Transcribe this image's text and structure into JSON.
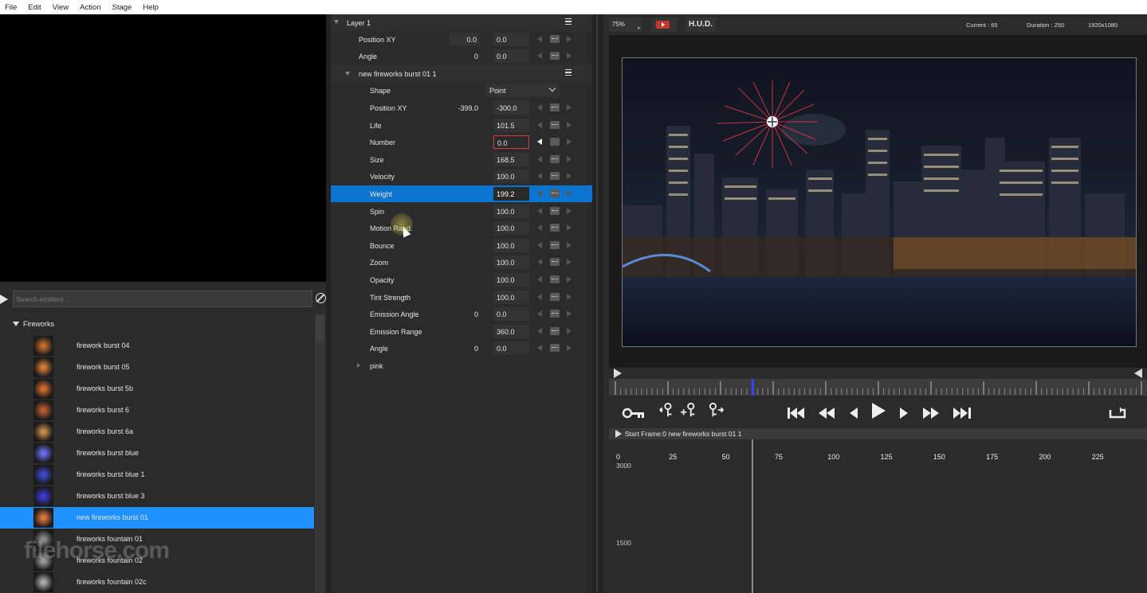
{
  "menu": [
    "File",
    "Edit",
    "View",
    "Action",
    "Stage",
    "Help"
  ],
  "search": {
    "placeholder": "Search emitters ..."
  },
  "emitters": {
    "group": "Fireworks",
    "items": [
      {
        "label": "firework burst 04",
        "color": "#c46a2a"
      },
      {
        "label": "firework burst 05",
        "color": "#d27a34"
      },
      {
        "label": "fireworks burst 5b",
        "color": "#cf6a2c"
      },
      {
        "label": "fireworks burst 6",
        "color": "#b65a32"
      },
      {
        "label": "fireworks burst 6a",
        "color": "#c8874a"
      },
      {
        "label": "fireworks burst blue",
        "color": "#6a6af0"
      },
      {
        "label": "fireworks burst blue 1",
        "color": "#3c48c8"
      },
      {
        "label": "fireworks burst blue 3",
        "color": "#3a3ad2"
      },
      {
        "label": "new fireworks burst 01",
        "color": "#d9763a",
        "selected": true
      },
      {
        "label": "fireworks fountain 01",
        "color": "#8a8a8a"
      },
      {
        "label": "fireworks fountain 02",
        "color": "#9a9a9a"
      },
      {
        "label": "fireworks fountain 02c",
        "color": "#aaaaaa"
      }
    ]
  },
  "watermark": "filehorse.com",
  "props": {
    "layer": "Layer 1",
    "layer_position_label": "Position XY",
    "layer_position_x": "0.0",
    "layer_position_y": "0.0",
    "layer_angle_label": "Angle",
    "layer_angle_v1": "0",
    "layer_angle_v2": "0.0",
    "emitter": "new fireworks burst 01 1",
    "shape_label": "Shape",
    "shape_value": "Point",
    "rows": [
      {
        "label": "Position XY",
        "v1": "-399.0",
        "v2": "-300.0"
      },
      {
        "label": "Life",
        "v2": "101.5"
      },
      {
        "label": "Number",
        "v2": "0.0",
        "editing": true
      },
      {
        "label": "Size",
        "v2": "168.5"
      },
      {
        "label": "Velocity",
        "v2": "100.0"
      },
      {
        "label": "Weight",
        "v2": "199.2",
        "selected": true
      },
      {
        "label": "Spin",
        "v2": "100.0"
      },
      {
        "label": "Motion Rand.",
        "v2": "100.0"
      },
      {
        "label": "Bounce",
        "v2": "100.0"
      },
      {
        "label": "Zoom",
        "v2": "100.0"
      },
      {
        "label": "Opacity",
        "v2": "100.0"
      },
      {
        "label": "Tint Strength",
        "v2": "100.0"
      },
      {
        "label": "Emission Angle",
        "v1": "0",
        "v2": "0.0"
      },
      {
        "label": "Emission Range",
        "v2": "360.0"
      },
      {
        "label": "Angle",
        "v1": "0",
        "v2": "0.0"
      }
    ],
    "sub_layer": "pink"
  },
  "stage": {
    "zoom": "75%",
    "hud": "H.U.D.",
    "current": "Current : 65",
    "duration": "Duration : 250",
    "resolution": "1920x1080"
  },
  "timeline": {
    "info": "Start Frame:0 new fireworks burst 01 1",
    "x_ticks": [
      "0",
      "25",
      "50",
      "75",
      "100",
      "125",
      "150",
      "175",
      "200",
      "225"
    ],
    "y_ticks": [
      "3000",
      "1500"
    ]
  },
  "colors": {
    "selection": "#1e90ff",
    "prop_selection": "#0a74d0",
    "accent": "#3344ff"
  }
}
